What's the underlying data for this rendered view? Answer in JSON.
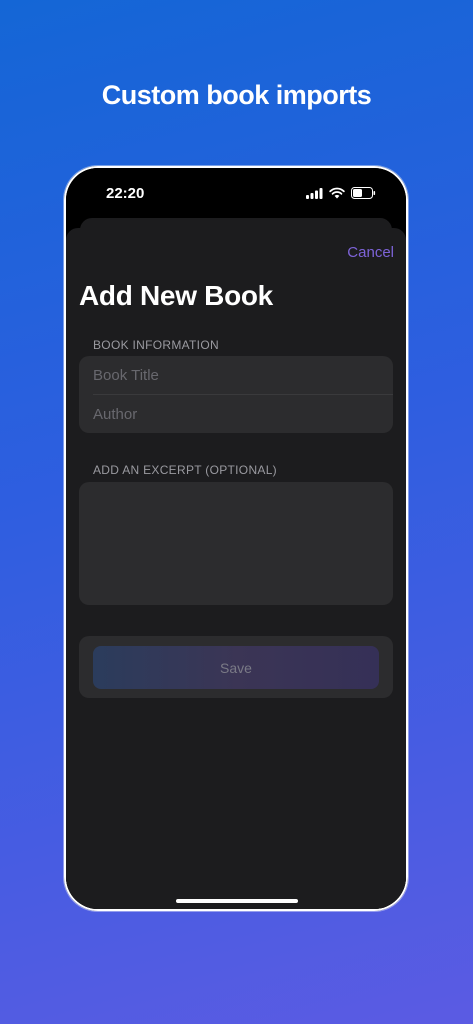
{
  "headline": "Custom book imports",
  "status_bar": {
    "time": "22:20",
    "icons": [
      "signal-icon",
      "wifi-icon",
      "battery-icon"
    ]
  },
  "sheet": {
    "cancel_label": "Cancel",
    "title": "Add New Book",
    "book_info_header": "BOOK INFORMATION",
    "title_placeholder": "Book Title",
    "author_placeholder": "Author",
    "excerpt_header": "ADD AN EXCERPT (OPTIONAL)",
    "save_label": "Save"
  },
  "colors": {
    "accent": "#7d63d8",
    "sheet_background": "#1c1c1e",
    "field_background": "#2c2c2e"
  }
}
